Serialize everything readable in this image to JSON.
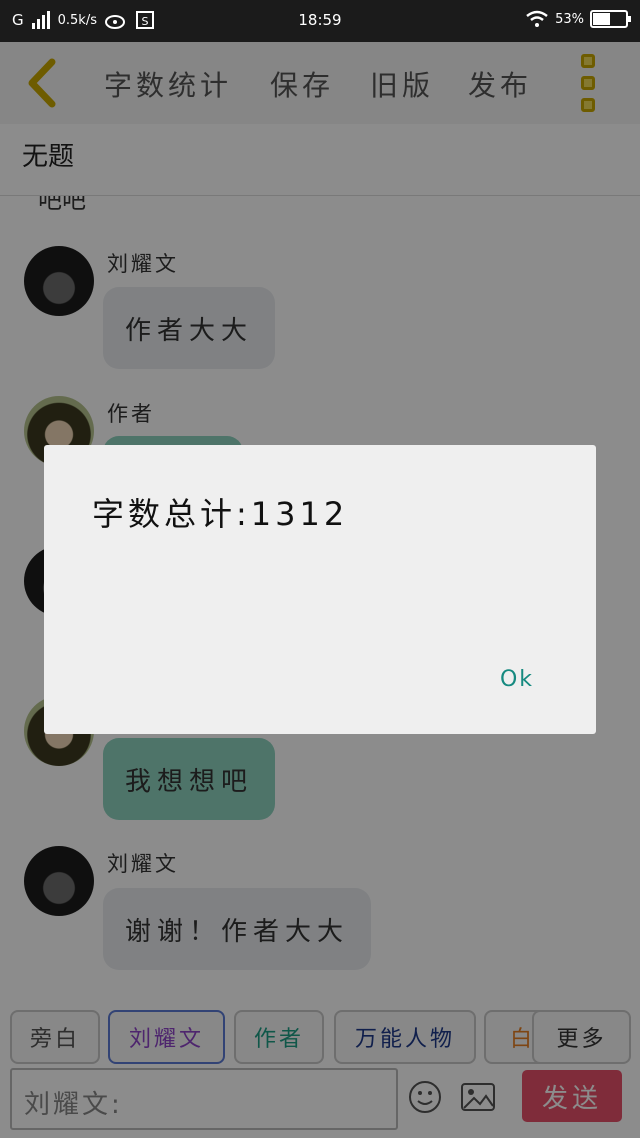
{
  "status_bar": {
    "network": "G",
    "speed": "0.5k/s",
    "time": "18:59",
    "battery": "53%",
    "battery_level": 0.53
  },
  "toolbar": {
    "word_count": "字数统计",
    "save": "保存",
    "old_version": "旧版",
    "publish": "发布"
  },
  "document": {
    "title": "无题"
  },
  "chat": {
    "partial_text": "吧吧",
    "messages": [
      {
        "sender": "刘耀文",
        "text": "作者大大"
      },
      {
        "sender": "作者",
        "text": ""
      },
      {
        "sender": "",
        "text": ""
      },
      {
        "sender": "",
        "text": "我想想吧"
      },
      {
        "sender": "刘耀文",
        "text": "谢谢！作者大大"
      }
    ]
  },
  "dialog": {
    "message": "字数总计:1312",
    "ok_label": "Ok"
  },
  "roles": [
    {
      "label": "旁白",
      "color": "#555555"
    },
    {
      "label": "刘耀文",
      "color": "#8e44c8"
    },
    {
      "label": "作者",
      "color": "#1e9e86"
    },
    {
      "label": "万能人物",
      "color": "#1e3a8a"
    },
    {
      "label": "白",
      "color": "#e67e22"
    },
    {
      "label": "更多",
      "color": "#333333"
    }
  ],
  "input": {
    "placeholder": "刘耀文:",
    "send_label": "发送"
  }
}
